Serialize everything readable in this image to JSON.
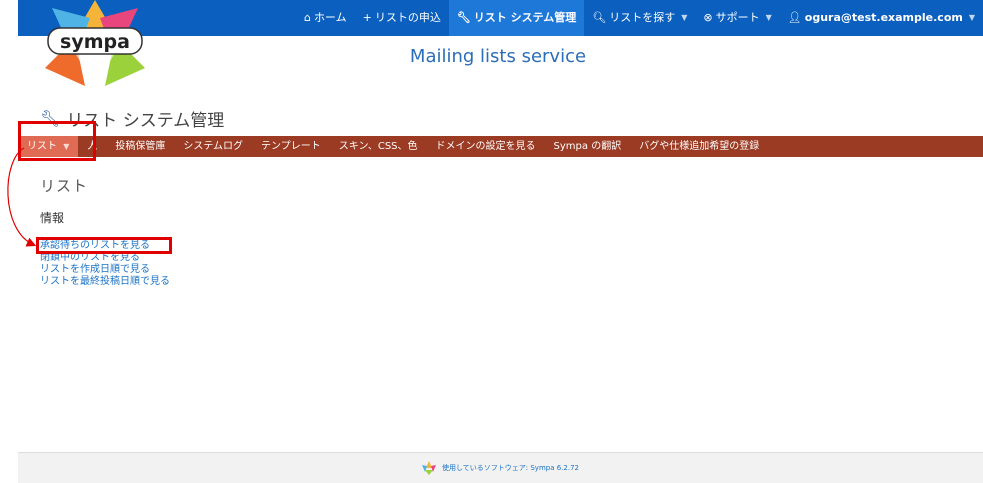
{
  "topnav": {
    "home": "ホーム",
    "request_list": "リストの申込",
    "list_admin": "リスト システム管理",
    "search_list": "リストを探す",
    "support": "サポート",
    "user_email": "ogura@test.example.com"
  },
  "logo_text": "sympa",
  "service_title": "Mailing lists service",
  "admin_heading": "リスト システム管理",
  "admin_tabs": [
    "リスト",
    "人",
    "投稿保管庫",
    "システムログ",
    "テンプレート",
    "スキン、CSS、色",
    "ドメインの設定を見る",
    "Sympa の翻訳",
    "バグや仕様追加希望の登録"
  ],
  "section_title": "リスト",
  "info_label": "情報",
  "links": [
    "承認待ちのリストを見る",
    "閉鎖中のリストを見る",
    "リストを作成日順で見る",
    "リストを最終投稿日順で見る"
  ],
  "footer": {
    "text": "使用しているソフトウェア: Sympa 6.2.72"
  },
  "colors": {
    "topnav": "#0a5fbf",
    "adminbar": "#9c3b24",
    "active_tab": "#e06b55",
    "annotation": "#e00000"
  }
}
